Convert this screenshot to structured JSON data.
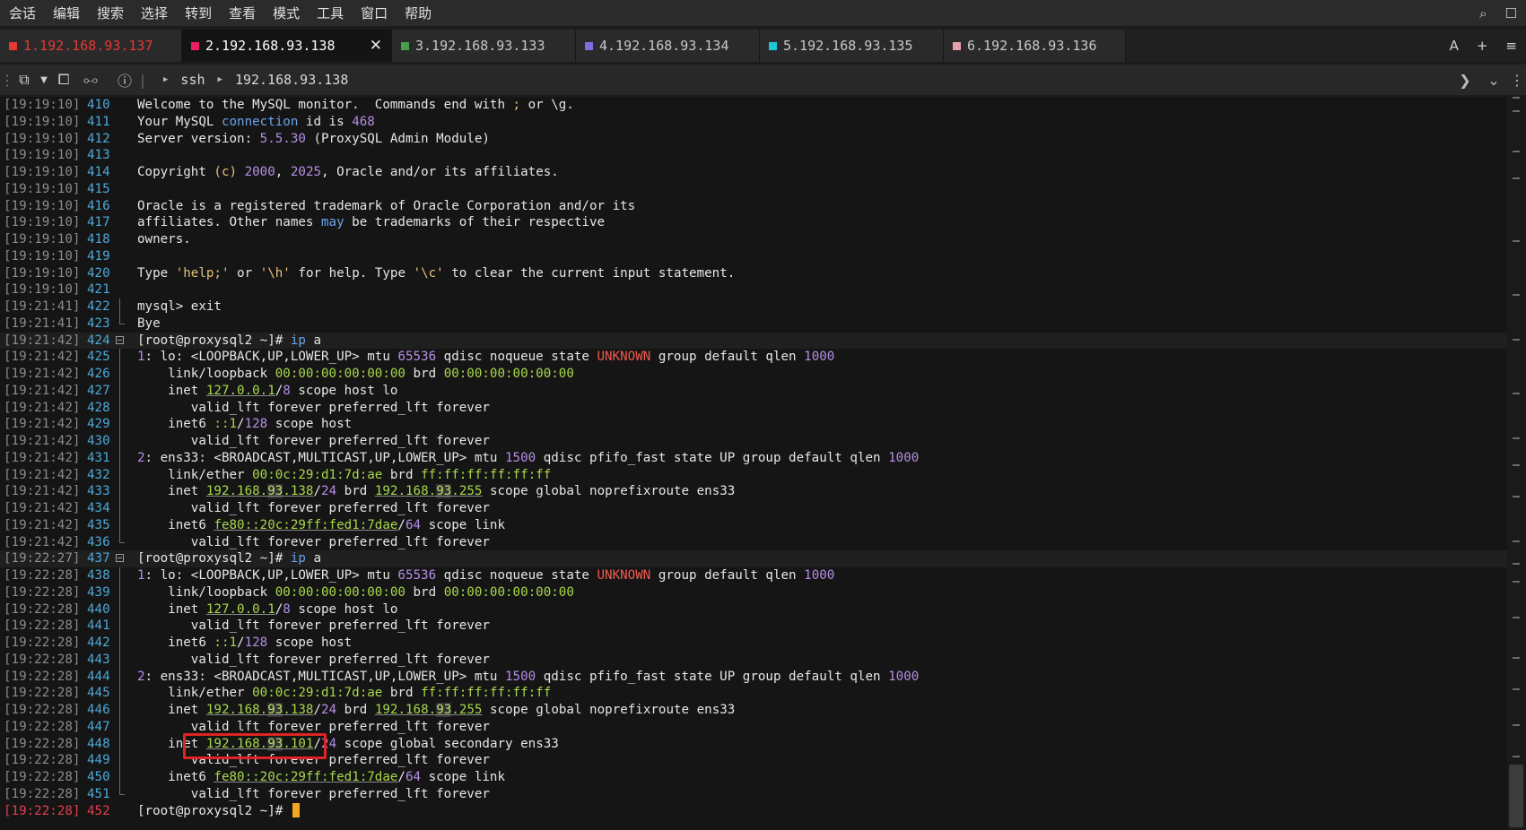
{
  "menu": {
    "items": [
      "会话",
      "编辑",
      "搜索",
      "选择",
      "转到",
      "查看",
      "模式",
      "工具",
      "窗口",
      "帮助"
    ]
  },
  "tabs": [
    {
      "label": "1.192.168.93.137",
      "color": "#e53935",
      "active": false,
      "text_color": "#e53935"
    },
    {
      "label": "2.192.168.93.138",
      "color": "#e91e63",
      "active": true,
      "text_color": "#ffffff"
    },
    {
      "label": "3.192.168.93.133",
      "color": "#43a047",
      "active": false,
      "text_color": "#c8c8c8"
    },
    {
      "label": "4.192.168.93.134",
      "color": "#7e6fe0",
      "active": false,
      "text_color": "#c8c8c8"
    },
    {
      "label": "5.192.168.93.135",
      "color": "#1ec8d8",
      "active": false,
      "text_color": "#c8c8c8"
    },
    {
      "label": "6.192.168.93.136",
      "color": "#e8a0a8",
      "active": false,
      "text_color": "#c8c8c8"
    }
  ],
  "tabs_right": {
    "font_label": "A",
    "add_label": "+",
    "menu_label": "≡"
  },
  "toolbar": {
    "path": [
      "ssh",
      "192.168.93.138"
    ]
  },
  "terminal": {
    "lines": [
      {
        "ts": "[19:19:10]",
        "ln": "410",
        "html": "Welcome to the MySQL monitor.  Commands end with <span class=\"s\">;</span> or \\g."
      },
      {
        "ts": "[19:19:10]",
        "ln": "411",
        "html": "Your MySQL <span class=\"k\">connection</span> id is <span class=\"n\">468</span>"
      },
      {
        "ts": "[19:19:10]",
        "ln": "412",
        "html": "Server version: <span class=\"n\">5.5.30</span> (ProxySQL Admin Module)"
      },
      {
        "ts": "[19:19:10]",
        "ln": "413",
        "html": ""
      },
      {
        "ts": "[19:19:10]",
        "ln": "414",
        "html": "Copyright <span class=\"s\">(c)</span> <span class=\"n\">2000</span>, <span class=\"n\">2025</span>, Oracle and/or its affiliates."
      },
      {
        "ts": "[19:19:10]",
        "ln": "415",
        "html": ""
      },
      {
        "ts": "[19:19:10]",
        "ln": "416",
        "html": "Oracle is a registered trademark of Oracle Corporation and/or its"
      },
      {
        "ts": "[19:19:10]",
        "ln": "417",
        "html": "affiliates. Other names <span class=\"k\">may</span> be trademarks of their respective"
      },
      {
        "ts": "[19:19:10]",
        "ln": "418",
        "html": "owners."
      },
      {
        "ts": "[19:19:10]",
        "ln": "419",
        "html": ""
      },
      {
        "ts": "[19:19:10]",
        "ln": "420",
        "html": "Type <span class=\"s\">'help;'</span> or <span class=\"s\">'\\h'</span> for help. Type <span class=\"s\">'\\c'</span> to clear the current input statement."
      },
      {
        "ts": "[19:19:10]",
        "ln": "421",
        "html": ""
      },
      {
        "ts": "[19:21:41]",
        "ln": "422",
        "html": "mysql&gt; exit",
        "guide": "line"
      },
      {
        "ts": "[19:21:41]",
        "ln": "423",
        "html": "Bye",
        "guide": "end"
      },
      {
        "ts": "[19:21:42]",
        "ln": "424",
        "html": "[root@proxysql2 ~]# <span class=\"k\">ip</span> a",
        "fold": true,
        "hl": true
      },
      {
        "ts": "[19:21:42]",
        "ln": "425",
        "html": "<span class=\"n\">1</span>: lo: &lt;LOOPBACK,UP,LOWER_UP&gt; mtu <span class=\"n\">65536</span> qdisc noqueue state <span class=\"r\">UNKNOWN</span> group default qlen <span class=\"n\">1000</span>",
        "guide": "line"
      },
      {
        "ts": "[19:21:42]",
        "ln": "426",
        "html": "    link/loopback <span class=\"g\">00:00:00:00:00:00</span> brd <span class=\"g\">00:00:00:00:00:00</span>",
        "guide": "line"
      },
      {
        "ts": "[19:21:42]",
        "ln": "427",
        "html": "    inet <span class=\"g u\">127.0.0.1</span>/<span class=\"n\">8</span> scope host lo",
        "guide": "line"
      },
      {
        "ts": "[19:21:42]",
        "ln": "428",
        "html": "       valid_lft forever preferred_lft forever",
        "guide": "line"
      },
      {
        "ts": "[19:21:42]",
        "ln": "429",
        "html": "    inet6 <span class=\"g\">::1</span>/<span class=\"n\">128</span> scope host",
        "guide": "line"
      },
      {
        "ts": "[19:21:42]",
        "ln": "430",
        "html": "       valid_lft forever preferred_lft forever",
        "guide": "line"
      },
      {
        "ts": "[19:21:42]",
        "ln": "431",
        "html": "<span class=\"n\">2</span>: ens33: &lt;BROADCAST,MULTICAST,UP,LOWER_UP&gt; mtu <span class=\"n\">1500</span> qdisc pfifo_fast state UP group default qlen <span class=\"n\">1000</span>",
        "guide": "line"
      },
      {
        "ts": "[19:21:42]",
        "ln": "432",
        "html": "    link/ether <span class=\"g\">00:0c:29:d1:7d:ae</span> brd <span class=\"g\">ff:ff:ff:ff:ff:ff</span>",
        "guide": "line"
      },
      {
        "ts": "[19:21:42]",
        "ln": "433",
        "html": "    inet <span class=\"g u\">192.168.<span class=\"ipb\">93</span>.138</span>/<span class=\"n\">24</span> brd <span class=\"g u\">192.168.<span class=\"ipb\">93</span>.255</span> scope global noprefixroute ens33",
        "guide": "line"
      },
      {
        "ts": "[19:21:42]",
        "ln": "434",
        "html": "       valid_lft forever preferred_lft forever",
        "guide": "line"
      },
      {
        "ts": "[19:21:42]",
        "ln": "435",
        "html": "    inet6 <span class=\"g u\">fe80::20c:29ff:fed1:7dae</span>/<span class=\"n\">64</span> scope link",
        "guide": "line"
      },
      {
        "ts": "[19:21:42]",
        "ln": "436",
        "html": "       valid_lft forever preferred_lft forever",
        "guide": "end"
      },
      {
        "ts": "[19:22:27]",
        "ln": "437",
        "html": "[root@proxysql2 ~]# <span class=\"k\">ip</span> a",
        "fold": true,
        "hl": true
      },
      {
        "ts": "[19:22:28]",
        "ln": "438",
        "html": "<span class=\"n\">1</span>: lo: &lt;LOOPBACK,UP,LOWER_UP&gt; mtu <span class=\"n\">65536</span> qdisc noqueue state <span class=\"r\">UNKNOWN</span> group default qlen <span class=\"n\">1000</span>",
        "guide": "line"
      },
      {
        "ts": "[19:22:28]",
        "ln": "439",
        "html": "    link/loopback <span class=\"g\">00:00:00:00:00:00</span> brd <span class=\"g\">00:00:00:00:00:00</span>",
        "guide": "line"
      },
      {
        "ts": "[19:22:28]",
        "ln": "440",
        "html": "    inet <span class=\"g u\">127.0.0.1</span>/<span class=\"n\">8</span> scope host lo",
        "guide": "line"
      },
      {
        "ts": "[19:22:28]",
        "ln": "441",
        "html": "       valid_lft forever preferred_lft forever",
        "guide": "line"
      },
      {
        "ts": "[19:22:28]",
        "ln": "442",
        "html": "    inet6 <span class=\"g\">::1</span>/<span class=\"n\">128</span> scope host",
        "guide": "line"
      },
      {
        "ts": "[19:22:28]",
        "ln": "443",
        "html": "       valid_lft forever preferred_lft forever",
        "guide": "line"
      },
      {
        "ts": "[19:22:28]",
        "ln": "444",
        "html": "<span class=\"n\">2</span>: ens33: &lt;BROADCAST,MULTICAST,UP,LOWER_UP&gt; mtu <span class=\"n\">1500</span> qdisc pfifo_fast state UP group default qlen <span class=\"n\">1000</span>",
        "guide": "line"
      },
      {
        "ts": "[19:22:28]",
        "ln": "445",
        "html": "    link/ether <span class=\"g\">00:0c:29:d1:7d:ae</span> brd <span class=\"g\">ff:ff:ff:ff:ff:ff</span>",
        "guide": "line"
      },
      {
        "ts": "[19:22:28]",
        "ln": "446",
        "html": "    inet <span class=\"g u\">192.168.<span class=\"ipb\">93</span>.138</span>/<span class=\"n\">24</span> brd <span class=\"g u\">192.168.<span class=\"ipb\">93</span>.255</span> scope global noprefixroute ens33",
        "guide": "line"
      },
      {
        "ts": "[19:22:28]",
        "ln": "447",
        "html": "       valid_lft forever preferred_lft forever",
        "guide": "line"
      },
      {
        "ts": "[19:22:28]",
        "ln": "448",
        "html": "    inet <span class=\"g u\">192.168.<span class=\"ipb\">93</span>.101</span>/<span class=\"n\">24</span> scope global secondary ens33",
        "guide": "line"
      },
      {
        "ts": "[19:22:28]",
        "ln": "449",
        "html": "       valid_lft forever preferred_lft forever",
        "guide": "line"
      },
      {
        "ts": "[19:22:28]",
        "ln": "450",
        "html": "    inet6 <span class=\"g u\">fe80::20c:29ff:fed1:7dae</span>/<span class=\"n\">64</span> scope link",
        "guide": "line"
      },
      {
        "ts": "[19:22:28]",
        "ln": "451",
        "html": "       valid_lft forever preferred_lft forever",
        "guide": "end"
      },
      {
        "ts": "[19:22:28]",
        "ln": "452",
        "html": "[root@proxysql2 ~]# <span class=\"cursor\"></span>",
        "cur": true
      }
    ]
  },
  "colors": {
    "accent_red": "#e02424",
    "cursor": "#f5a623",
    "line_number": "#4da8d8"
  }
}
